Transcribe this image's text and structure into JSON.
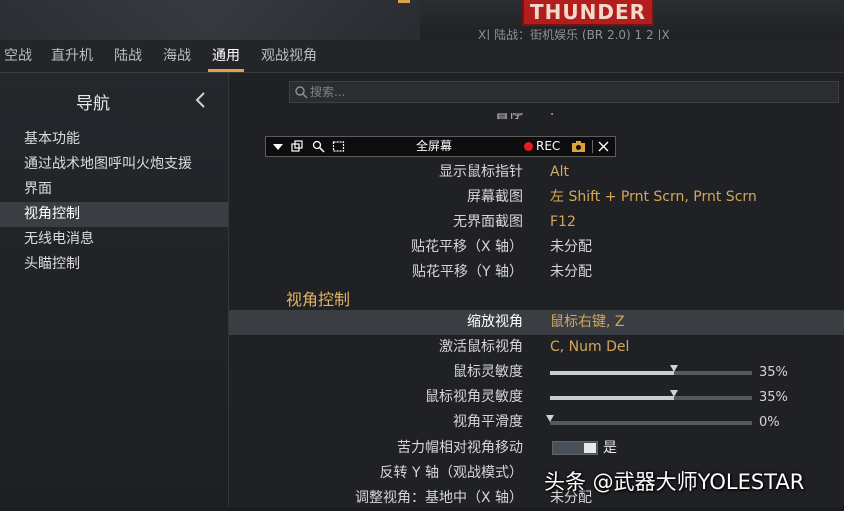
{
  "banner": {
    "logo_text": "THUNDER",
    "mode_text": "X| 陆战：街机娱乐 (BR 2.0) 1 2 |X"
  },
  "tabs": [
    {
      "label": "空战",
      "active": false
    },
    {
      "label": "直升机",
      "active": false
    },
    {
      "label": "陆战",
      "active": false
    },
    {
      "label": "海战",
      "active": false
    },
    {
      "label": "通用",
      "active": true
    },
    {
      "label": "观战视角",
      "active": false
    }
  ],
  "sidebar": {
    "title": "导航",
    "items": [
      {
        "label": "基本功能"
      },
      {
        "label": "通过战术地图呼叫火炮支援"
      },
      {
        "label": "界面"
      },
      {
        "label": "视角控制",
        "active": true
      },
      {
        "label": "无线电消息"
      },
      {
        "label": "头瞄控制"
      }
    ]
  },
  "search": {
    "placeholder": "搜索..."
  },
  "recorder": {
    "fullscreen_label": "全屏幕",
    "rec_label": "REC"
  },
  "rows_top": [
    {
      "label": "暂停",
      "value": "P"
    },
    {
      "label": "显示鼠标指针",
      "value": "Alt"
    },
    {
      "label": "屏幕截图",
      "value": "左 Shift + Prnt Scrn, Prnt Scrn"
    },
    {
      "label": "无界面截图",
      "value": "F12"
    },
    {
      "label": "贴花平移（X 轴）",
      "value": "未分配"
    },
    {
      "label": "贴花平移（Y 轴）",
      "value": "未分配"
    }
  ],
  "section_title": "视角控制",
  "rows_view": [
    {
      "label": "缩放视角",
      "value": "鼠标右键, Z"
    },
    {
      "label": "激活鼠标视角",
      "value": "C, Num Del"
    }
  ],
  "sliders": [
    {
      "label": "鼠标灵敏度",
      "value": 0.35,
      "value_text": "35%"
    },
    {
      "label": "鼠标视角灵敏度",
      "value": 0.35,
      "value_text": "35%"
    },
    {
      "label": "视角平滑度",
      "value": 0.0,
      "value_text": "0%"
    }
  ],
  "toggle": {
    "label": "苦力帽相对视角移动",
    "on": true,
    "text": "是"
  },
  "rows_bottom": [
    {
      "label": "反转 Y 轴（观战模式）",
      "value": ""
    },
    {
      "label": "调整视角：基地中（X 轴）",
      "value": "未分配"
    }
  ],
  "watermark": "头条 @武器大师YOLESTAR",
  "colors": {
    "accent": "#e0a34a",
    "value_gold": "#d4a85a",
    "logo_red": "#b21e1e"
  }
}
